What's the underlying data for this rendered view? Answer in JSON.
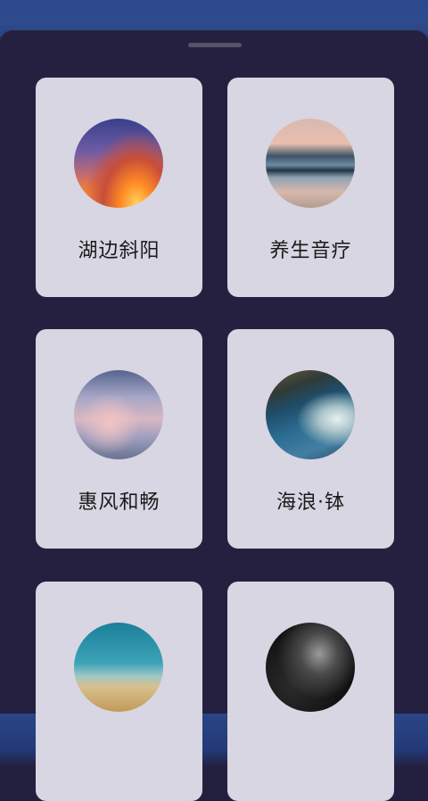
{
  "cards": [
    {
      "label": "湖边斜阳",
      "thumb": "sunset-over-lake"
    },
    {
      "label": "养生音疗",
      "thumb": "calm-sea-horizon"
    },
    {
      "label": "惠风和畅",
      "thumb": "pastel-clouds"
    },
    {
      "label": "海浪·钵",
      "thumb": "ocean-waves-coast"
    },
    {
      "label": "",
      "thumb": "grass-under-blue-sky"
    },
    {
      "label": "",
      "thumb": "starry-galaxy"
    }
  ]
}
